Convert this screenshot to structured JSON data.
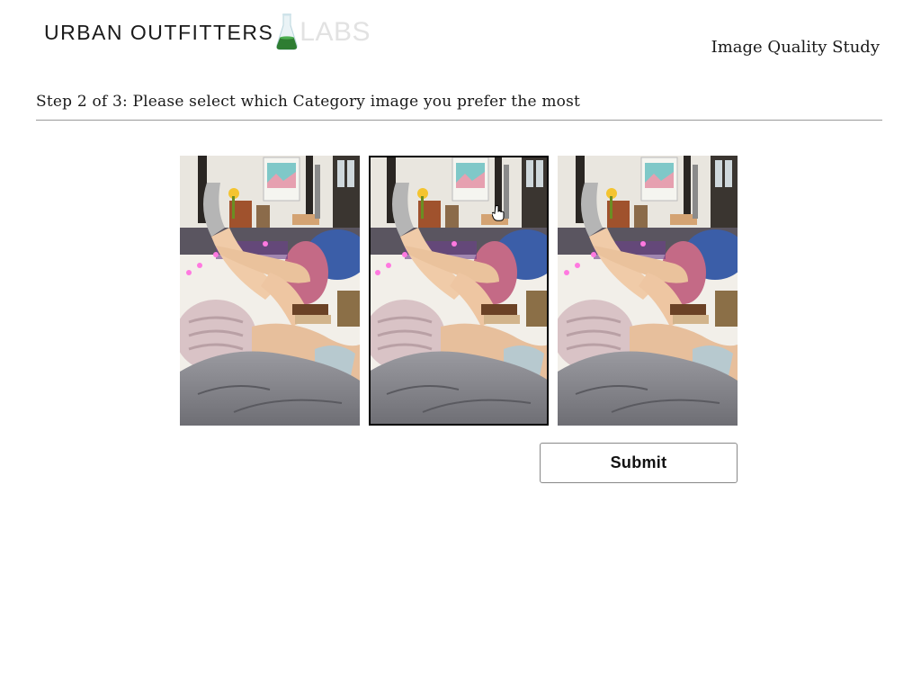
{
  "header": {
    "logo_text": "URBAN OUTFITTERS",
    "logo_suffix": "LABS",
    "study_title": "Image Quality Study"
  },
  "step": {
    "heading": "Step 2 of 3: Please select which Category image you prefer the most"
  },
  "options": [
    {
      "name": "option-1",
      "selected": false
    },
    {
      "name": "option-2",
      "selected": true
    },
    {
      "name": "option-3",
      "selected": false
    }
  ],
  "submit": {
    "label": "Submit"
  },
  "colors": {
    "flask_liquid": "#2e7d32",
    "labs_text": "#e2e2e2",
    "rule": "#9a9a9a"
  }
}
